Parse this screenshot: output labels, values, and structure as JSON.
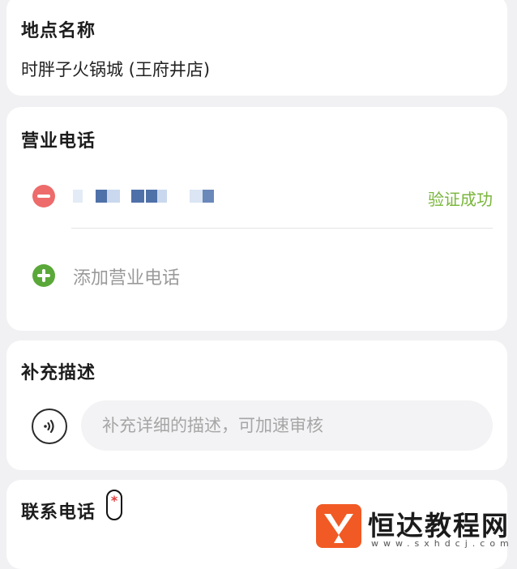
{
  "location": {
    "title": "地点名称",
    "value": "时胖子火锅城 (王府井店)"
  },
  "phone": {
    "title": "营业电话",
    "verify_status": "验证成功",
    "add_label": "添加营业电话"
  },
  "description": {
    "title": "补充描述",
    "placeholder": "补充详细的描述，可加速审核"
  },
  "contact": {
    "title": "联系电话",
    "required_mark": "*"
  },
  "watermark": {
    "text": "恒达教程网",
    "url": "www.sxhdcj.com"
  },
  "colors": {
    "success": "#79b63a",
    "remove": "#ee6b6b",
    "add": "#5aa839",
    "required": "#e23b3b",
    "brand": "#f15a24"
  }
}
